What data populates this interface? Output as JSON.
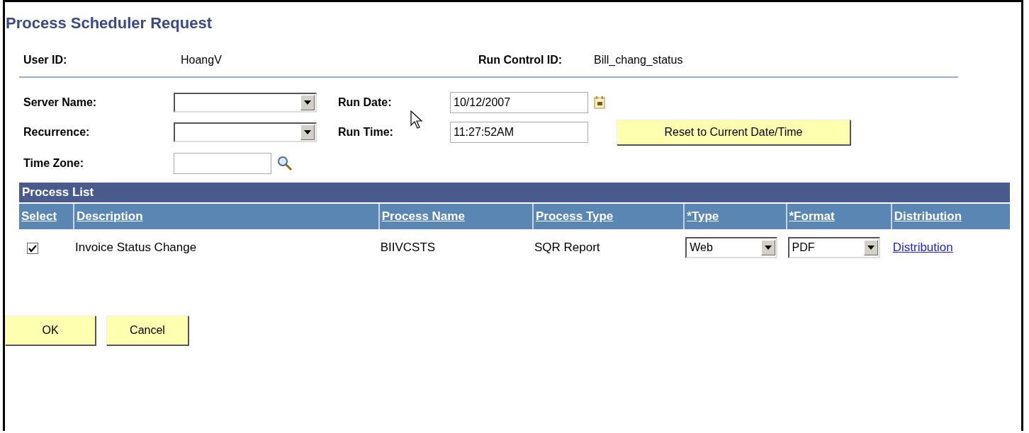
{
  "title": "Process Scheduler Request",
  "user_id": {
    "label": "User ID:",
    "value": "HoangV"
  },
  "run_control_id": {
    "label": "Run Control ID:",
    "value": "Bill_chang_status"
  },
  "server_name": {
    "label": "Server Name:"
  },
  "recurrence": {
    "label": "Recurrence:"
  },
  "time_zone": {
    "label": "Time Zone:"
  },
  "run_date": {
    "label": "Run Date:",
    "value": "10/12/2007"
  },
  "run_time": {
    "label": "Run Time:",
    "value": "11:27:52AM"
  },
  "reset_button": "Reset to Current Date/Time",
  "process_list": {
    "title": "Process List",
    "columns": [
      "Select",
      "Description",
      "Process Name",
      "Process Type",
      "*Type",
      "*Format",
      "Distribution"
    ],
    "rows": [
      {
        "checked": true,
        "description": "Invoice Status Change",
        "process_name": "BIIVCSTS",
        "process_type": "SQR Report",
        "type": "Web",
        "format": "PDF",
        "distribution": "Distribution"
      }
    ]
  },
  "buttons": [
    "OK",
    "Cancel"
  ]
}
